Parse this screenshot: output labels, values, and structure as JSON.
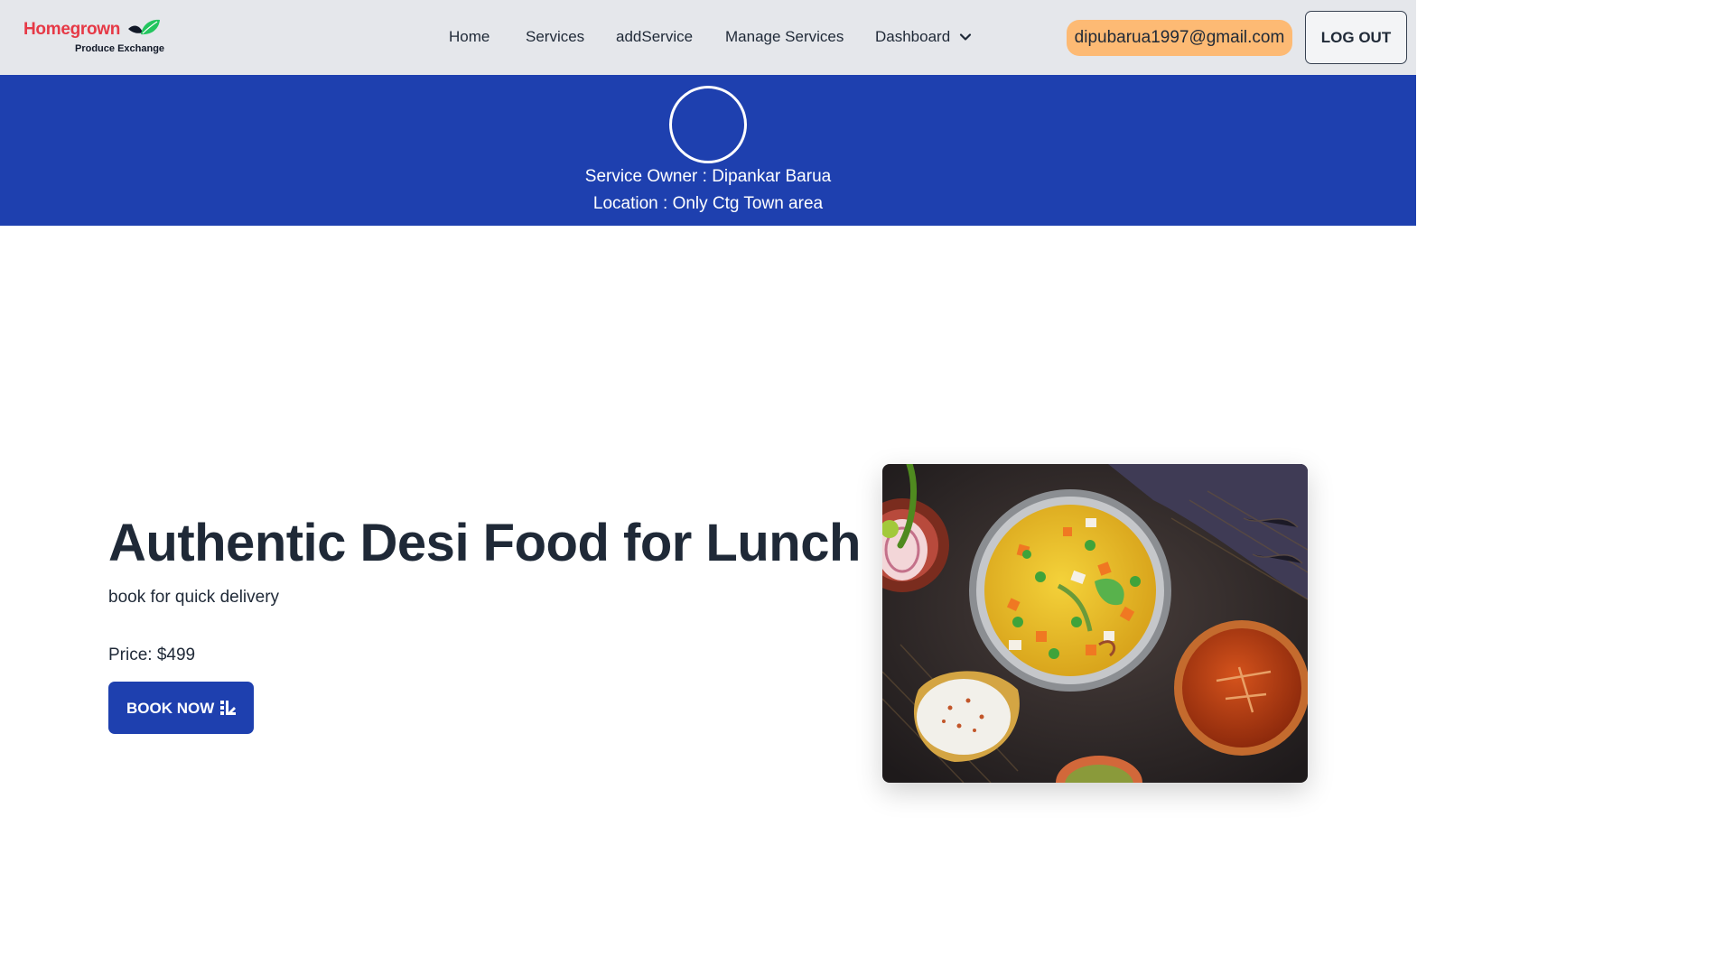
{
  "brand": {
    "name": "Homegrown",
    "tagline": "Produce Exchange",
    "name_color": "#e63946",
    "leaf_colors": [
      "#111827",
      "#22c55e"
    ]
  },
  "nav": {
    "home": "Home",
    "services": "Services",
    "add_service": "addService",
    "manage_services": "Manage Services",
    "dashboard": "Dashboard",
    "dashboard_icon": "chevron-down-icon"
  },
  "user": {
    "email": "dipubarua1997@gmail.com",
    "logout_label": "LOG OUT"
  },
  "banner": {
    "owner": "Service Owner : Dipankar Barua",
    "location": "Location : Only Ctg Town area",
    "background": "#1e40af"
  },
  "service": {
    "title": "Authentic Desi Food for Lunch",
    "subtitle": "book for quick delivery",
    "price": "Price: $499",
    "book_label": "BOOK NOW",
    "book_icon": "edit-icon",
    "image_alt": "biryani-bowl-photo"
  },
  "colors": {
    "navbar_bg": "#e5e7eb",
    "accent": "#1e40af",
    "email_pill": "#fdba74"
  }
}
